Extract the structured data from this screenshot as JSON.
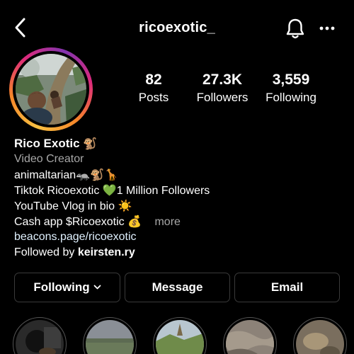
{
  "header": {
    "username": "ricoexotic_"
  },
  "stats": [
    {
      "value": "82",
      "label": "Posts"
    },
    {
      "value": "27.3K",
      "label": "Followers"
    },
    {
      "value": "3,559",
      "label": "Following"
    }
  ],
  "bio": {
    "name": "Rico Exotic",
    "name_emoji": "🐒",
    "category": "Video Creator",
    "line1": "animaltarian",
    "line1_emoji": "🦡🐒🦒",
    "line2_a": "Tiktok Ricoexotic",
    "line2_emoji": "💚",
    "line2_b": "1 Million Followers",
    "line3": "YouTube Vlog in bio",
    "line3_emoji": "☀️",
    "line4": "Cash app $Ricoexotic",
    "line4_emoji": "💰",
    "more": "more",
    "link": "beacons.page/ricoexotic",
    "followed_by_prefix": "Followed by",
    "followed_by_user": "keirsten.ry"
  },
  "buttons": {
    "following": "Following",
    "message": "Message",
    "email": "Email"
  },
  "icons": {
    "back": "back-arrow-icon",
    "bell": "bell-icon",
    "more": "more-options-icon",
    "chevron": "chevron-down-icon"
  }
}
